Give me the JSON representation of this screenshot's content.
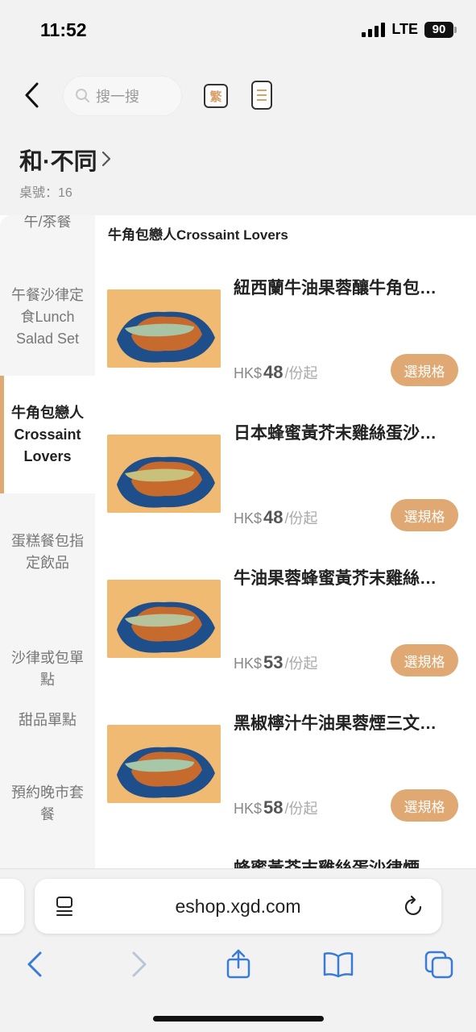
{
  "status_bar": {
    "time": "11:52",
    "network": "LTE",
    "battery": "90"
  },
  "nav": {
    "search_placeholder": "搜一搜",
    "lang_label": "繁"
  },
  "store": {
    "name": "和·不同",
    "table_label": "桌號：16"
  },
  "sidebar": {
    "items": [
      {
        "label": "午/茶餐"
      },
      {
        "label": "午餐沙律定食Lunch Salad Set"
      },
      {
        "label": "牛角包戀人Crossaint Lovers",
        "active": true
      },
      {
        "label": "蛋糕餐包指定飲品"
      },
      {
        "label": "沙律或包單點"
      },
      {
        "label": "甜品單點"
      },
      {
        "label": "預約晚市套餐"
      }
    ]
  },
  "section": {
    "title": "牛角包戀人Crossaint Lovers"
  },
  "products": [
    {
      "name": "紐西蘭牛油果蓉釀牛角包…",
      "currency": "HK$",
      "price": "48",
      "unit": "/份起",
      "button": "選規格",
      "topping": "#a9c4a4"
    },
    {
      "name": "日本蜂蜜黃芥末雞絲蛋沙…",
      "currency": "HK$",
      "price": "48",
      "unit": "/份起",
      "button": "選規格",
      "topping": "#c9c07c"
    },
    {
      "name": "牛油果蓉蜂蜜黃芥末雞絲…",
      "currency": "HK$",
      "price": "53",
      "unit": "/份起",
      "button": "選規格",
      "topping": "#b7c39a"
    },
    {
      "name": "黑椒檸汁牛油果蓉煙三文…",
      "currency": "HK$",
      "price": "58",
      "unit": "/份起",
      "button": "選規格",
      "topping": "#a7c7a9"
    },
    {
      "name": "蜂蜜黃芥末雞絲蛋沙律煙…"
    }
  ],
  "browser": {
    "url": "eshop.xgd.com"
  },
  "colors": {
    "accent": "#e0a872",
    "background": "#f2f2f2"
  }
}
